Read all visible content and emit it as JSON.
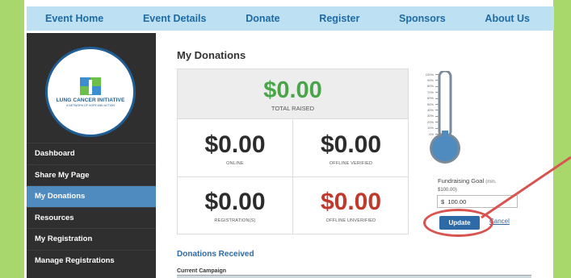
{
  "nav": {
    "items": [
      "Event Home",
      "Event Details",
      "Donate",
      "Register",
      "Sponsors",
      "About Us"
    ]
  },
  "logo": {
    "name": "LUNG CANCER INITIATIVE",
    "tagline": "A NETWORK OF HOPE AND ACTION"
  },
  "sidebar": {
    "items": [
      {
        "label": "Dashboard",
        "active": false
      },
      {
        "label": "Share My Page",
        "active": false
      },
      {
        "label": "My Donations",
        "active": true
      },
      {
        "label": "Resources",
        "active": false
      },
      {
        "label": "My Registration",
        "active": false
      },
      {
        "label": "Manage Registrations",
        "active": false
      }
    ]
  },
  "main": {
    "title": "My Donations",
    "total": {
      "amount": "$0.00",
      "label": "TOTAL RAISED"
    },
    "cells": [
      {
        "amount": "$0.00",
        "label": "ONLINE"
      },
      {
        "amount": "$0.00",
        "label": "OFFLINE VERIFIED"
      },
      {
        "amount": "$0.00",
        "label": "REGISTRATION(S)"
      },
      {
        "amount": "$0.00",
        "label": "OFFLINE UNVERIFIED"
      }
    ],
    "donations_received": "Donations Received",
    "current_campaign": "Current Campaign"
  },
  "thermometer": {
    "ticks": [
      "100%",
      "90%",
      "80%",
      "70%",
      "60%",
      "50%",
      "40%",
      "30%",
      "20%",
      "10%",
      "0%"
    ],
    "fill_fraction": 0.0,
    "colors": {
      "tube": "#7a8a99",
      "fill": "#4f8bbf"
    }
  },
  "goal": {
    "label": "Fundraising Goal",
    "label_hint": "(min.",
    "sub": "$100.00)",
    "value": "$  100.00",
    "update_label": "Update",
    "cancel_label": "Cancel"
  },
  "colors": {
    "brand_green": "#a8d86b",
    "nav_bg": "#bde0f2",
    "nav_text": "#1d6aa5",
    "total_green": "#4aa54a",
    "unverified_red": "#c0392b",
    "annotation_red": "#d9534f"
  }
}
